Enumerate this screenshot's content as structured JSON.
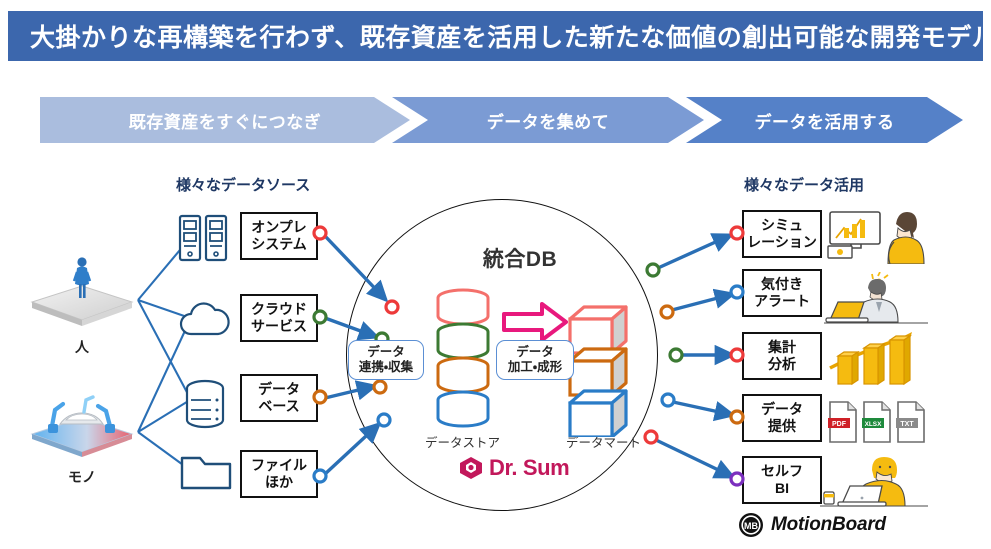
{
  "banner": {
    "title": "大掛かりな再構築を行わず、既存資産を活用した新たな価値の創出可能な開発モデル",
    "bg_color": "#3c67ad"
  },
  "steps": [
    {
      "label": "既存資産をすぐにつなぎ",
      "color": "#aabdde"
    },
    {
      "label": "データを集めて",
      "color": "#7b9bd4"
    },
    {
      "label": "データを活用する",
      "color": "#5581c8"
    }
  ],
  "sections": {
    "sources_heading": "様々なデータソース",
    "usage_heading": "様々なデータ活用"
  },
  "actors": [
    {
      "label": "人",
      "icon": "businessman-platform-icon"
    },
    {
      "label": "モノ",
      "icon": "factory-robot-platform-icon"
    }
  ],
  "sources": [
    {
      "line1": "オンプレ",
      "line2": "システム",
      "icon": "server-icon",
      "dot_color": "#ed3a3a"
    },
    {
      "line1": "クラウド",
      "line2": "サービス",
      "icon": "cloud-icon",
      "dot_color": "#3c7a33"
    },
    {
      "line1": "データ",
      "line2": "ベース",
      "icon": "database-icon",
      "dot_color": "#cc6a10"
    },
    {
      "line1": "ファイル",
      "line2": "ほか",
      "icon": "folder-icon",
      "dot_color": "#2a7cc7"
    }
  ],
  "hub": {
    "title": "統合DB",
    "collect_label_line1": "データ",
    "collect_label_line2": "連携・収集",
    "transform_label_line1": "データ",
    "transform_label_line2": "加工・成形",
    "store_label": "データストア",
    "mart_label": "データマート",
    "store_colors": [
      "#f4706b",
      "#3c7a33",
      "#cc6a10",
      "#2a7cc7"
    ],
    "mart_colors": [
      "#f4706b",
      "#cc6a10",
      "#2a7cc7"
    ],
    "arrow_color": "#e8197d",
    "product_logo": "Dr. Sum",
    "product_logo_color": "#c2185b"
  },
  "usages": [
    {
      "line1": "シミュ",
      "line2": "レーション",
      "dot_color": "#ed3a3a",
      "hub_dot_color": "#3c7a33",
      "illustration": "person-monitor-chart-icon"
    },
    {
      "line1": "気付き",
      "line2": "アラート",
      "dot_color": "#2a7cc7",
      "hub_dot_color": "#cc6a10",
      "illustration": "person-laptop-alert-icon"
    },
    {
      "line1": "集計",
      "line2": "分析",
      "dot_color": "#ed3a3a",
      "hub_dot_color": "#3c7a33",
      "illustration": "bar-chart-growth-icon"
    },
    {
      "line1": "データ",
      "line2": "提供",
      "dot_color": "#cc6a10",
      "hub_dot_color": "#2a7cc7",
      "illustration": "file-formats-icon"
    },
    {
      "line1": "セルフ",
      "line2": "BI",
      "dot_color": "#7b2fbe",
      "hub_dot_color": "#ed3a3a",
      "illustration": "woman-laptop-icon"
    }
  ],
  "file_badges": [
    {
      "label": "PDF",
      "color": "#cf2027"
    },
    {
      "label": "XLSX",
      "color": "#1e8a3c"
    },
    {
      "label": "TXT",
      "color": "#8a8a8a"
    }
  ],
  "footer_logo": {
    "text": "MotionBoard",
    "badge": "MB"
  }
}
